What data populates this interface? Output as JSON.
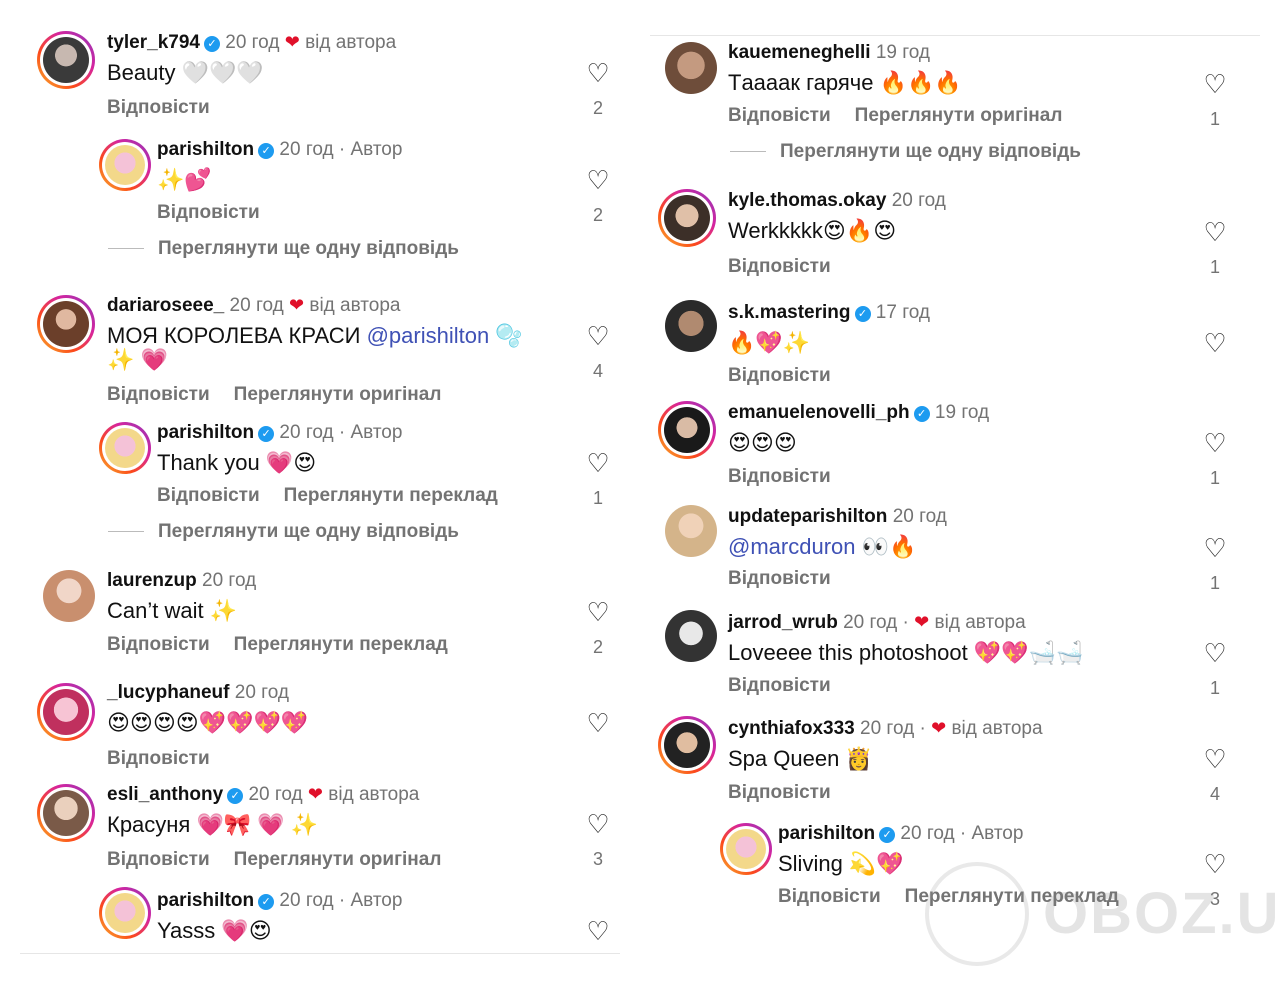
{
  "labels": {
    "reply": "Відповісти",
    "view_original": "Переглянути оригінал",
    "view_translation": "Переглянути переклад",
    "view_more_reply": "Переглянути ще одну відповідь",
    "by_author": "від автора",
    "author": "Автор"
  },
  "icons": {
    "like": "heart-outline-icon",
    "verified": "verified-badge-icon",
    "author_like": "red-heart-icon"
  },
  "colors": {
    "mention": "#3f51b5",
    "verified": "#1d9bf0",
    "muted": "#737373",
    "author_heart": "#e0102a"
  },
  "left": {
    "c1": {
      "user": "tyler_k794",
      "time": "20 год",
      "text": "Beauty 🤍🤍🤍",
      "likes": "2"
    },
    "r1": {
      "user": "parishilton",
      "time": "20 год",
      "text": "✨💕",
      "likes": "2"
    },
    "c2": {
      "user": "dariaroseee_",
      "time": "20 год",
      "text_a": "МОЯ КОРОЛЕВА КРАСИ ",
      "mention": "@parishilton",
      "text_b": " 🫧",
      "text_line2": "✨ 💗",
      "likes": "4"
    },
    "r2": {
      "user": "parishilton",
      "time": "20 год",
      "text": "Thank you 💗😍",
      "likes": "1"
    },
    "c3": {
      "user": "laurenzup",
      "time": "20 год",
      "text": "Can’t wait ✨",
      "likes": "2"
    },
    "c4": {
      "user": "_lucyphaneuf",
      "time": "20 год",
      "text": "😍😍😍😍💖💖💖💖"
    },
    "c5": {
      "user": "esli_anthony",
      "time": "20 год",
      "text": "Красуня 💗🎀 💗 ✨",
      "likes": "3"
    },
    "r3": {
      "user": "parishilton",
      "time": "20 год",
      "text": "Yasss 💗😍"
    }
  },
  "right": {
    "c1": {
      "user": "kauemeneghelli",
      "time": "19 год",
      "text": "Тaaaак гаряче 🔥🔥🔥",
      "likes": "1"
    },
    "c2": {
      "user": "kyle.thomas.okay",
      "time": "20 год",
      "text": "Werkkkkk😍🔥😍",
      "likes": "1"
    },
    "c3": {
      "user": "s.k.mastering",
      "time": "17 год",
      "text": "🔥💖✨"
    },
    "c4": {
      "user": "emanuelenovelli_ph",
      "time": "19 год",
      "text": "😍😍😍",
      "likes": "1"
    },
    "c5": {
      "user": "updateparishilton",
      "time": "20 год",
      "mention": "@marcduron",
      "text": " 👀🔥",
      "likes": "1"
    },
    "c6": {
      "user": "jarrod_wrub",
      "time": "20 год",
      "text": "Loveeee this photoshoot 💖💖🛁🛁",
      "likes": "1"
    },
    "c7": {
      "user": "cynthiafox333",
      "time": "20 год",
      "text": "Spa Queen 👸",
      "likes": "4"
    },
    "r1": {
      "user": "parishilton",
      "time": "20 год",
      "text": "Sliving 💫💖",
      "likes": "3"
    }
  },
  "watermark": {
    "text": "OBOZ.UA"
  }
}
